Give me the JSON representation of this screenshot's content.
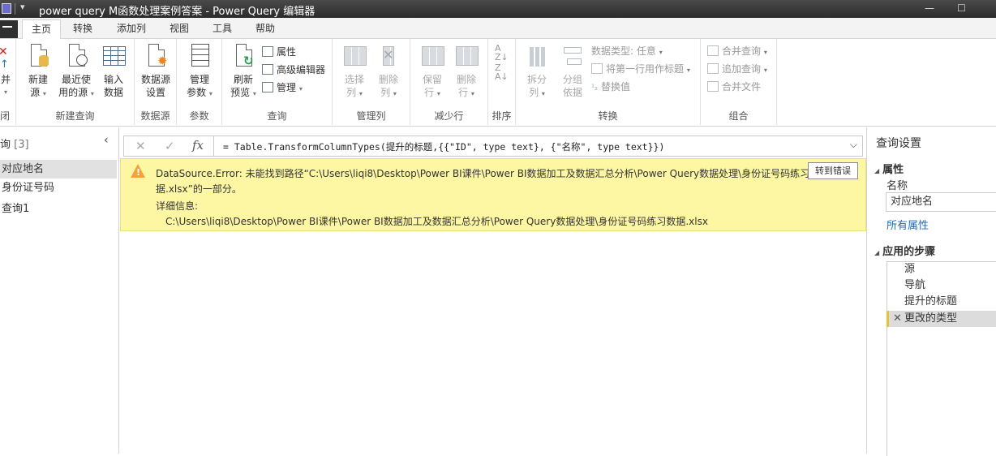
{
  "window": {
    "title": "power query M函数处理案例答案 - Power Query 编辑器"
  },
  "tabs": [
    {
      "label": "主页",
      "active": true
    },
    {
      "label": "转换"
    },
    {
      "label": "添加列"
    },
    {
      "label": "视图"
    },
    {
      "label": "工具"
    },
    {
      "label": "帮助"
    }
  ],
  "ribbon": {
    "partial": {
      "line1": "并",
      "line2": "▾",
      "group": "闭"
    },
    "new_query": {
      "group": "新建查询",
      "new_source": {
        "line1": "新建",
        "line2": "源"
      },
      "recent_sources": {
        "line1": "最近使",
        "line2": "用的源"
      },
      "enter_data": {
        "line1": "输入",
        "line2": "数据"
      }
    },
    "data_source": {
      "group": "数据源",
      "settings": {
        "line1": "数据源",
        "line2": "设置"
      }
    },
    "parameters": {
      "group": "参数",
      "manage": {
        "line1": "管理",
        "line2": "参数"
      }
    },
    "query": {
      "group": "查询",
      "refresh": {
        "line1": "刷新",
        "line2": "预览"
      },
      "properties": "属性",
      "advanced_editor": "高级编辑器",
      "manage": "管理"
    },
    "manage_columns": {
      "group": "管理列",
      "choose": {
        "line1": "选择",
        "line2": "列"
      },
      "remove": {
        "line1": "删除",
        "line2": "列"
      }
    },
    "reduce_rows": {
      "group": "减少行",
      "keep": {
        "line1": "保留",
        "line2": "行"
      },
      "remove": {
        "line1": "删除",
        "line2": "行"
      }
    },
    "sort": {
      "group": "排序"
    },
    "transform": {
      "group": "转换",
      "split": {
        "line1": "拆分",
        "line2": "列"
      },
      "group_by": {
        "line1": "分组",
        "line2": "依据"
      },
      "data_type": "数据类型: 任意",
      "first_row_header": "将第一行用作标题",
      "replace_values": "替换值"
    },
    "combine": {
      "group": "组合",
      "merge_queries": "合并查询",
      "append_queries": "追加查询",
      "combine_files": "合并文件"
    }
  },
  "left_pane": {
    "title": "询",
    "count": "[3]",
    "queries": [
      "对应地名",
      "身份证号码",
      "查询1"
    ]
  },
  "formula_bar": {
    "formula": "= Table.TransformColumnTypes(提升的标题,{{\"ID\", type text}, {\"名称\", type text}})"
  },
  "error": {
    "line1": "DataSource.Error: 未能找到路径“C:\\Users\\liqi8\\Desktop\\Power BI课件\\Power BI数据加工及数据汇总分析\\Power Query数据处理\\身份证号码练习数",
    "line2": "据.xlsx”的一部分。",
    "details_label": "详细信息:",
    "details": "C:\\Users\\liqi8\\Desktop\\Power BI课件\\Power BI数据加工及数据汇总分析\\Power Query数据处理\\身份证号码练习数据.xlsx",
    "goto_button": "转到错误"
  },
  "right_pane": {
    "title": "查询设置",
    "properties_header": "属性",
    "name_label": "名称",
    "name_value": "对应地名",
    "all_properties": "所有属性",
    "steps_header": "应用的步骤",
    "steps": [
      "源",
      "导航",
      "提升的标题",
      "更改的类型"
    ]
  },
  "colors": {
    "error_bg": "#fdf7a3",
    "link": "#1e6bb8",
    "selected_step_accent": "#e3c43a"
  }
}
